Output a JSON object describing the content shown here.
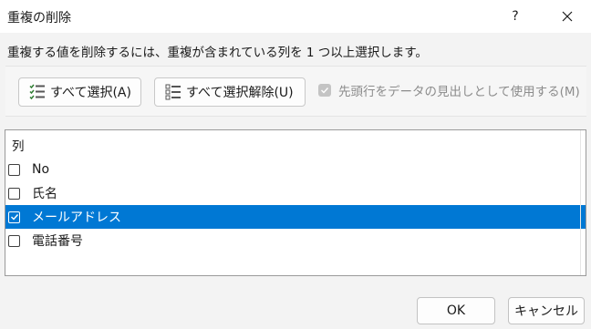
{
  "window": {
    "title": "重複の削除",
    "help_label": "?",
    "close_icon": "close-icon"
  },
  "instruction": "重複する値を削除するには、重複が含まれている列を 1 つ以上選択します。",
  "toolbar": {
    "select_all_label": "すべて選択(A)",
    "select_all_icon": "select-all-icon",
    "deselect_all_label": "すべて選択解除(U)",
    "deselect_all_icon": "deselect-all-icon",
    "header_checkbox_label": "先頭行をデータの見出しとして使用する(M)",
    "header_checkbox_checked": true,
    "header_checkbox_enabled": false
  },
  "columns": {
    "header": "列",
    "items": [
      {
        "label": "No",
        "checked": false,
        "selected": false
      },
      {
        "label": "氏名",
        "checked": false,
        "selected": false
      },
      {
        "label": "メールアドレス",
        "checked": true,
        "selected": true
      },
      {
        "label": "電話番号",
        "checked": false,
        "selected": false
      }
    ]
  },
  "buttons": {
    "ok": "OK",
    "cancel": "キャンセル"
  },
  "colors": {
    "accent": "#0078d4",
    "icon_green": "#2e7d32",
    "dialog_bg": "#f3f3f3"
  }
}
